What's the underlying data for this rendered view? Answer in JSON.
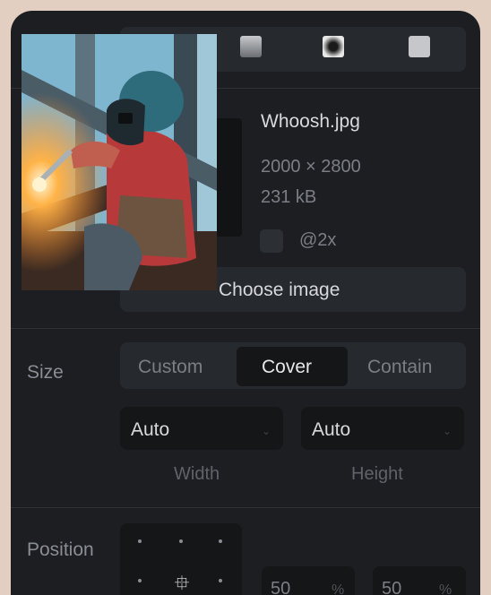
{
  "modes": [
    {
      "icon": "gradient-square-icon"
    },
    {
      "icon": "radial-gradient-icon"
    },
    {
      "icon": "solid-square-icon"
    }
  ],
  "image": {
    "file_name": "Whoosh.jpg",
    "dimensions": "2000 × 2800",
    "file_size": "231 kB",
    "retina_label": "@2x",
    "retina_checked": false,
    "choose_label": "Choose image"
  },
  "size": {
    "label": "Size",
    "options": [
      "Custom",
      "Cover",
      "Contain"
    ],
    "selected": "Cover",
    "width": {
      "value": "Auto",
      "caption": "Width"
    },
    "height": {
      "value": "Auto",
      "caption": "Height"
    }
  },
  "position": {
    "label": "Position",
    "x": {
      "value": "50",
      "unit": "%"
    },
    "y": {
      "value": "50",
      "unit": "%"
    }
  },
  "colors": {
    "page_bg": "#e3cfc2",
    "panel_bg": "#1c1e21",
    "control_bg": "#26292d",
    "input_bg": "#141618"
  }
}
